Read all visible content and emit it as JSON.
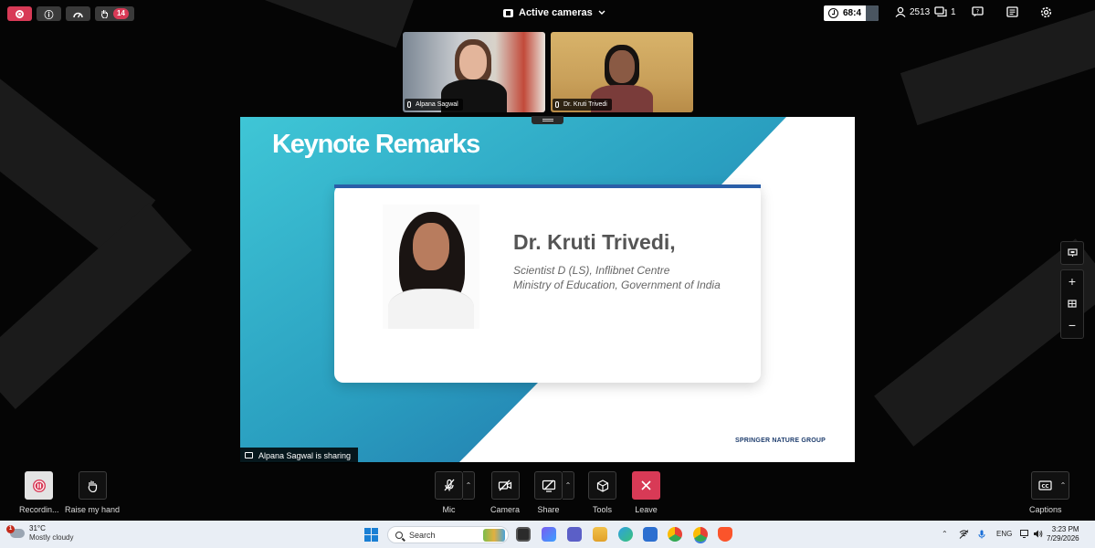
{
  "topbar": {
    "hand_count": "14",
    "layout_label": "Active cameras",
    "timer": "68:4",
    "participants_count": "2513",
    "chat_count": "1"
  },
  "participants": [
    {
      "name": "Alpana Sagwal"
    },
    {
      "name": "Dr. Kruti Trivedi"
    }
  ],
  "slide": {
    "title": "Keynote Remarks",
    "speaker_name": "Dr. Kruti Trivedi,",
    "role_line1": "Scientist D (LS), Inflibnet Centre",
    "role_line2": "Ministry of Education, Government of India",
    "brand": "SPRINGER NATURE GROUP"
  },
  "share_label": "Alpana Sagwal is sharing",
  "bottom": {
    "recording": "Recordin...",
    "raise_hand": "Raise my hand",
    "mic": "Mic",
    "camera": "Camera",
    "share": "Share",
    "tools": "Tools",
    "leave": "Leave",
    "captions": "Captions"
  },
  "taskbar": {
    "weather_temp": "31°C",
    "weather_desc": "Mostly cloudy",
    "weather_badge": "1",
    "search_placeholder": "Search",
    "lang": "ENG",
    "time": "3:23 PM",
    "date": "7/29/2026"
  },
  "colors": {
    "accent_red": "#d83a56",
    "slide_teal": "#2fb0c8",
    "slide_blue": "#2a5ea8"
  }
}
